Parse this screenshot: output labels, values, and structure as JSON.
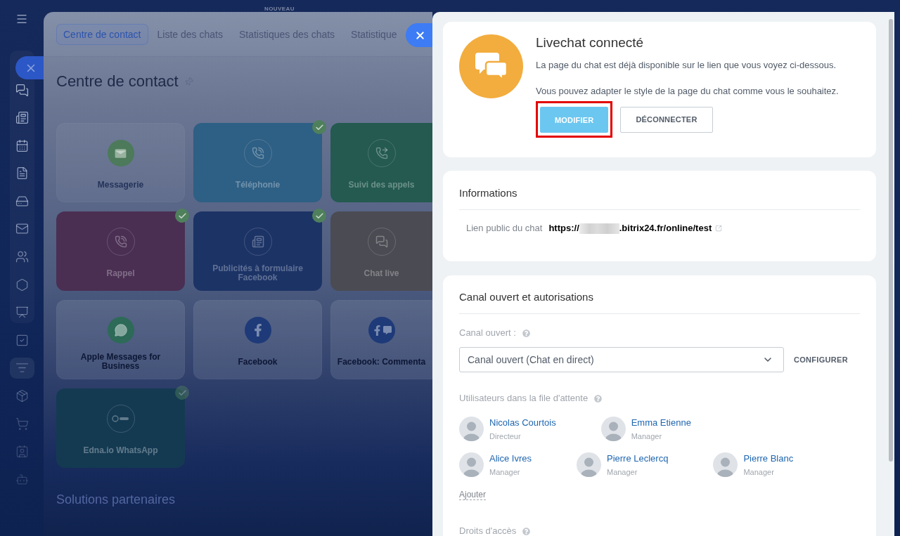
{
  "top_bar": {
    "badge": "NOUVEAU"
  },
  "sidebar": {
    "pinned": [
      {
        "selected": false
      },
      {
        "selected": false
      },
      {
        "selected": false
      },
      {
        "selected": false
      },
      {
        "selected": false
      },
      {
        "selected": false
      },
      {
        "selected": false
      },
      {
        "selected": false
      },
      {
        "selected": false
      }
    ],
    "more": [
      {
        "selected": false
      },
      {
        "selected": true
      },
      {
        "selected": false
      },
      {
        "selected": false
      },
      {
        "selected": false
      },
      {
        "selected": false
      }
    ]
  },
  "contact_center": {
    "tabs": [
      {
        "label": "Centre de contact",
        "selected": true
      },
      {
        "label": "Liste des chats",
        "selected": false
      },
      {
        "label": "Statistiques des chats",
        "selected": false
      },
      {
        "label": "Statistique",
        "selected": false
      }
    ],
    "title": "Centre de contact",
    "tiles": [
      {
        "label": "Messagerie",
        "kind": "plain",
        "color": "#4c7a5a",
        "connected": false
      },
      {
        "label": "Téléphonie",
        "kind": "colored",
        "color": "#2e5f84",
        "connected": true
      },
      {
        "label": "Suivi des appels",
        "kind": "colored",
        "color": "#245a50",
        "connected": false
      },
      {
        "label": "Rappel",
        "kind": "colored",
        "color": "#4a2f53",
        "connected": true
      },
      {
        "label": "Publicités à formulaire Facebook",
        "kind": "colored",
        "color": "#1c3366",
        "connected": true
      },
      {
        "label": "Chat live",
        "kind": "colored",
        "color": "#4b4b53",
        "connected": false
      },
      {
        "label": "Apple Messages for Business",
        "kind": "plain",
        "color": "#2d6a58",
        "connected": false
      },
      {
        "label": "Facebook",
        "kind": "plain",
        "color": "#1e3a78",
        "connected": false
      },
      {
        "label": "Facebook: Commenta",
        "kind": "plain",
        "color": "#1e3a78",
        "connected": false
      },
      {
        "label": "Edna.io WhatsApp",
        "kind": "colored",
        "color": "#143a52",
        "connected": true
      }
    ],
    "section_title": "Solutions partenaires"
  },
  "livechat": {
    "status": {
      "title": "Livechat connecté",
      "lines": [
        "La page du chat est déjà disponible sur le lien que vous voyez ci-dessous.",
        "Vous pouvez adapter le style de la page du chat comme vous le souhaitez."
      ],
      "buttons": [
        {
          "label": "MODIFIER",
          "kind": "primary",
          "highlighted": true
        },
        {
          "label": "DÉCONNECTER",
          "kind": "secondary",
          "highlighted": false
        }
      ]
    },
    "info": {
      "title": "Informations",
      "public_link": {
        "label": "Lien public du chat",
        "prefix": "https://",
        "suffix": ".bitrix24.fr/online/test",
        "redacted": true
      }
    },
    "channel": {
      "title": "Canal ouvert et autorisations",
      "field_label": "Canal ouvert :",
      "select_value": "Canal ouvert (Chat en direct)",
      "configure": "CONFIGURER",
      "queue_label": "Utilisateurs dans la file d'attente",
      "queue_rows": [
        {
          "users": [
            {
              "name": "Nicolas Courtois",
              "role": "Directeur"
            },
            {
              "name": "Emma Etienne",
              "role": "Manager"
            }
          ]
        },
        {
          "users": [
            {
              "name": "Alice Ivres",
              "role": "Manager"
            },
            {
              "name": "Pierre Leclercq",
              "role": "Manager"
            },
            {
              "name": "Pierre Blanc",
              "role": "Manager"
            }
          ]
        }
      ],
      "add": "Ajouter",
      "access_label": "Droits d'accès"
    }
  }
}
